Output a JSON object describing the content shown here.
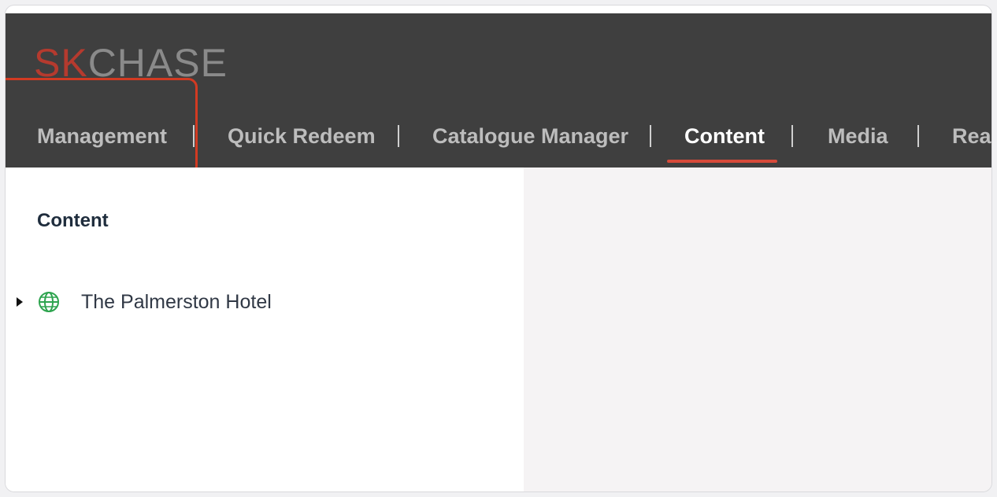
{
  "logo": {
    "part1": "SK",
    "part2": "CHASE"
  },
  "nav": {
    "items": [
      {
        "label": "Management"
      },
      {
        "label": "Quick Redeem"
      },
      {
        "label": "Catalogue Manager"
      },
      {
        "label": "Content"
      },
      {
        "label": "Media"
      },
      {
        "label": "Real"
      }
    ],
    "active": "Content"
  },
  "sidebar": {
    "title": "Content",
    "tree": [
      {
        "label": "The Palmerston Hotel"
      }
    ]
  },
  "colors": {
    "topbar": "#3f3f3f",
    "active_underline": "#d84a3a",
    "highlight_border": "#d23a22",
    "globe": "#2ea44f"
  }
}
